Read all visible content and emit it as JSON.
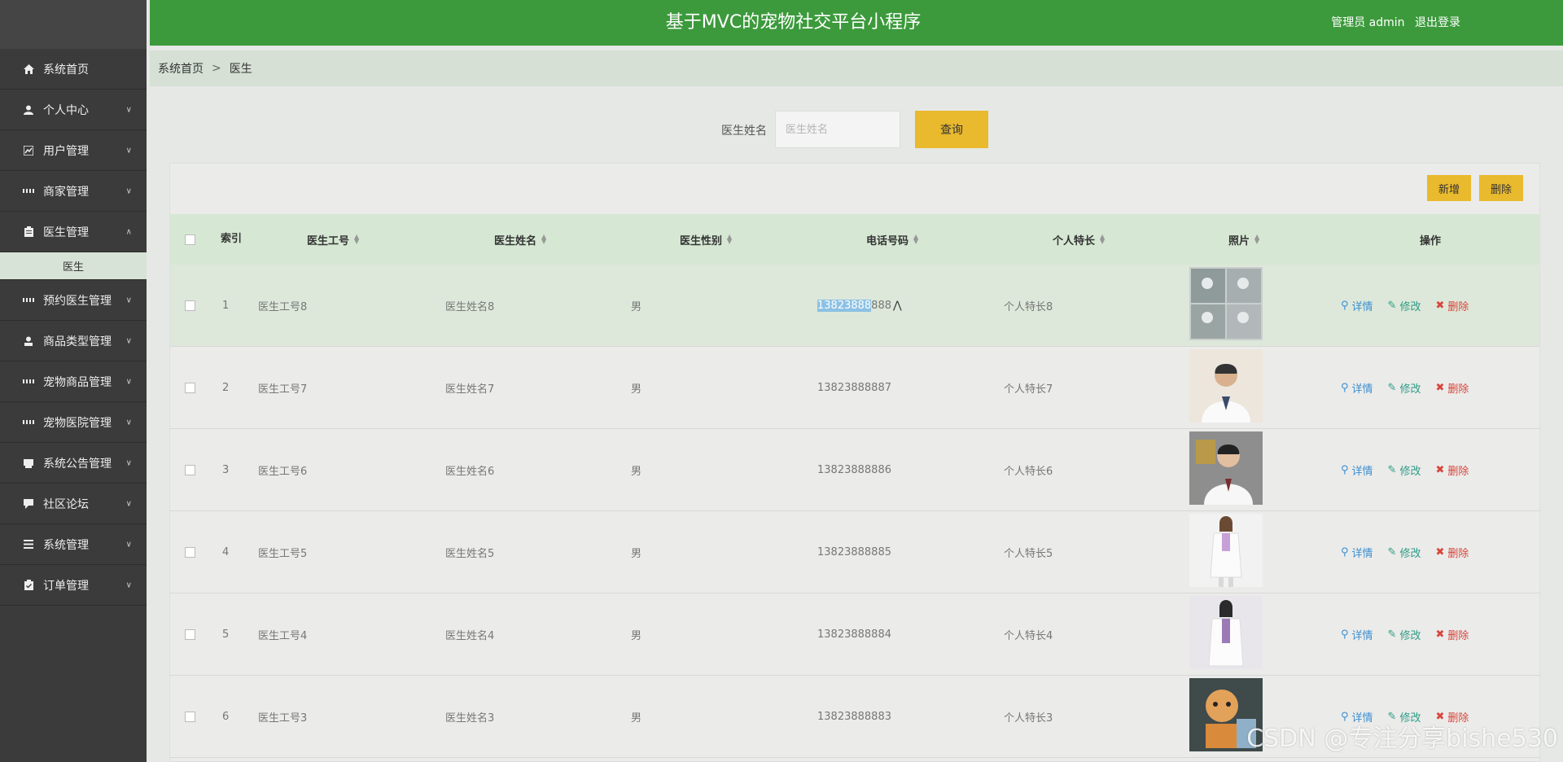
{
  "header": {
    "title": "基于MVC的宠物社交平台小程序",
    "user": "管理员 admin",
    "logout": "退出登录"
  },
  "sidebar": {
    "items": [
      {
        "label": "系统首页",
        "icon": "home-icon"
      },
      {
        "label": "个人中心",
        "icon": "user-icon"
      },
      {
        "label": "用户管理",
        "icon": "chart-icon"
      },
      {
        "label": "商家管理",
        "icon": "grid-icon"
      },
      {
        "label": "医生管理",
        "icon": "clipboard-icon",
        "expanded": true,
        "sub": "医生"
      },
      {
        "label": "预约医生管理",
        "icon": "grid-icon"
      },
      {
        "label": "商品类型管理",
        "icon": "person-icon"
      },
      {
        "label": "宠物商品管理",
        "icon": "grid-icon"
      },
      {
        "label": "宠物医院管理",
        "icon": "grid-icon"
      },
      {
        "label": "系统公告管理",
        "icon": "tray-icon"
      },
      {
        "label": "社区论坛",
        "icon": "comment-icon"
      },
      {
        "label": "系统管理",
        "icon": "list-icon"
      },
      {
        "label": "订单管理",
        "icon": "clipboard-icon"
      }
    ]
  },
  "breadcrumb": {
    "home": "系统首页",
    "sep": ">",
    "current": "医生"
  },
  "search": {
    "label": "医生姓名",
    "placeholder": "医生姓名",
    "button": "查询"
  },
  "toolbar": {
    "add": "新增",
    "delete": "删除"
  },
  "table": {
    "headers": {
      "index": "索引",
      "doc_no": "医生工号",
      "doc_name": "医生姓名",
      "gender": "医生性别",
      "phone": "电话号码",
      "specialty": "个人特长",
      "photo": "照片",
      "ops": "操作"
    },
    "ops": {
      "detail": "详情",
      "edit": "修改",
      "delete": "删除"
    },
    "rows": [
      {
        "idx": "1",
        "no": "医生工号8",
        "name": "医生姓名8",
        "gender": "男",
        "phone_sel": "13823888",
        "phone_rest": "888",
        "specialty": "个人特长8"
      },
      {
        "idx": "2",
        "no": "医生工号7",
        "name": "医生姓名7",
        "gender": "男",
        "phone": "13823888887",
        "specialty": "个人特长7"
      },
      {
        "idx": "3",
        "no": "医生工号6",
        "name": "医生姓名6",
        "gender": "男",
        "phone": "13823888886",
        "specialty": "个人特长6"
      },
      {
        "idx": "4",
        "no": "医生工号5",
        "name": "医生姓名5",
        "gender": "男",
        "phone": "13823888885",
        "specialty": "个人特长5"
      },
      {
        "idx": "5",
        "no": "医生工号4",
        "name": "医生姓名4",
        "gender": "男",
        "phone": "13823888884",
        "specialty": "个人特长4"
      },
      {
        "idx": "6",
        "no": "医生工号3",
        "name": "医生姓名3",
        "gender": "男",
        "phone": "13823888883",
        "specialty": "个人特长3"
      }
    ]
  },
  "watermark": "CSDN @专注分享bishe530"
}
